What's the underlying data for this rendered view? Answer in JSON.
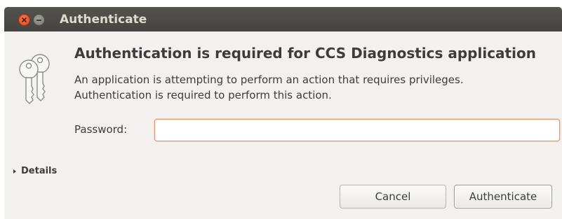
{
  "window": {
    "title": "Authenticate"
  },
  "dialog": {
    "icon": "keys-icon",
    "heading": "Authentication is required for CCS Diagnostics application",
    "message": "An application is attempting to perform an action that requires privileges. Authentication is required to perform this action.",
    "password_label": "Password:",
    "password_value": "",
    "password_placeholder": "",
    "details_label": "Details"
  },
  "buttons": {
    "cancel_label": "Cancel",
    "authenticate_label": "Authenticate"
  },
  "colors": {
    "titlebar": "#4a4844",
    "dialog_background": "#f2f1f0",
    "close_button": "#e5552c",
    "focus_border": "#e8956a"
  }
}
